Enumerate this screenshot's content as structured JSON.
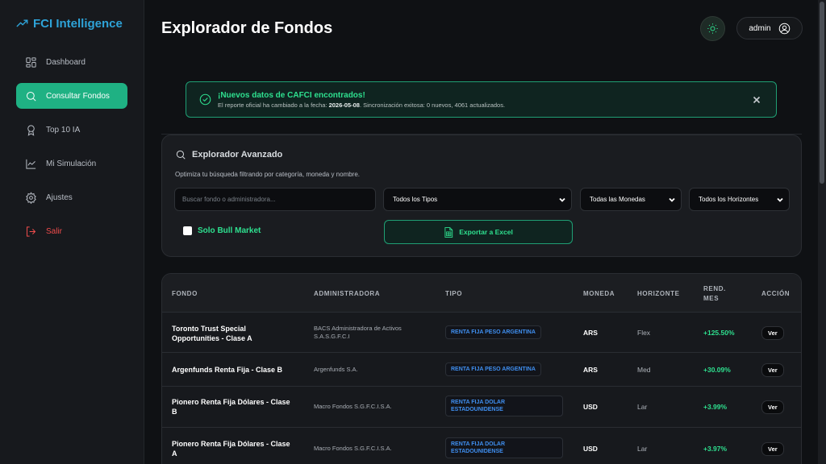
{
  "brand": {
    "name": "FCI Intelligence",
    "icon": "trending-up-icon"
  },
  "sidebar": {
    "items": [
      {
        "label": "Dashboard",
        "icon": "dashboard-grid-icon",
        "active": false
      },
      {
        "label": "Consultar Fondos",
        "icon": "search-icon",
        "active": true
      },
      {
        "label": "Top 10 IA",
        "icon": "award-icon",
        "active": false
      },
      {
        "label": "Mi Simulación",
        "icon": "line-chart-icon",
        "active": false
      },
      {
        "label": "Ajustes",
        "icon": "gear-icon",
        "active": false
      },
      {
        "label": "Salir",
        "icon": "logout-icon",
        "active": false
      }
    ]
  },
  "header": {
    "title": "Explorador de Fondos",
    "user": "admin"
  },
  "alert": {
    "title": "¡Nuevos datos de CAFCI encontrados!",
    "text_before": "El reporte oficial ha cambiado a la fecha: ",
    "date": "2026-05-08",
    "text_after": ". Sincronización exitosa: 0 nuevos, 4061 actualizados."
  },
  "explorer": {
    "title": "Explorador Avanzado",
    "subtitle": "Optimiza tu búsqueda filtrando por categoría, moneda y nombre.",
    "search_placeholder": "Buscar fondo o administradora...",
    "tipo_selected": "Todos los Tipos",
    "moneda_selected": "Todas las Monedas",
    "horizonte_selected": "Todos los Horizontes",
    "bull_label": "Solo Bull Market",
    "export_label": "Exportar a Excel"
  },
  "table": {
    "headers": {
      "fondo": "FONDO",
      "administradora": "ADMINISTRADORA",
      "tipo": "TIPO",
      "moneda": "MONEDA",
      "horizonte": "HORIZONTE",
      "rend_1": "REND.",
      "rend_2": "MES",
      "accion": "ACCIÓN"
    },
    "rows": [
      {
        "fondo": "Toronto Trust Special Opportunities - Clase A",
        "administradora": "BACS Administradora de Activos S.A.S.G.F.C.I",
        "tipo": "RENTA FIJA PESO ARGENTINA",
        "moneda": "ARS",
        "horizonte": "Flex",
        "rend": "+125.50%",
        "accion": "Ver"
      },
      {
        "fondo": "Argenfunds Renta Fija - Clase B",
        "administradora": "Argenfunds S.A.",
        "tipo": "RENTA FIJA PESO ARGENTINA",
        "moneda": "ARS",
        "horizonte": "Med",
        "rend": "+30.09%",
        "accion": "Ver"
      },
      {
        "fondo": "Pionero Renta Fija Dólares - Clase B",
        "administradora": "Macro Fondos S.G.F.C.I.S.A.",
        "tipo": "RENTA FIJA DOLAR ESTADOUNIDENSE",
        "moneda": "USD",
        "horizonte": "Lar",
        "rend": "+3.99%",
        "accion": "Ver"
      },
      {
        "fondo": "Pionero Renta Fija Dólares - Clase A",
        "administradora": "Macro Fondos S.G.F.C.I.S.A.",
        "tipo": "RENTA FIJA DOLAR ESTADOUNIDENSE",
        "moneda": "USD",
        "horizonte": "Lar",
        "rend": "+3.97%",
        "accion": "Ver"
      }
    ]
  },
  "colors": {
    "accent": "#1fb183",
    "accent_text": "#2ee08f",
    "brand": "#2ea3d8",
    "danger": "#f04c4c",
    "badge_text": "#3f8ff0"
  }
}
